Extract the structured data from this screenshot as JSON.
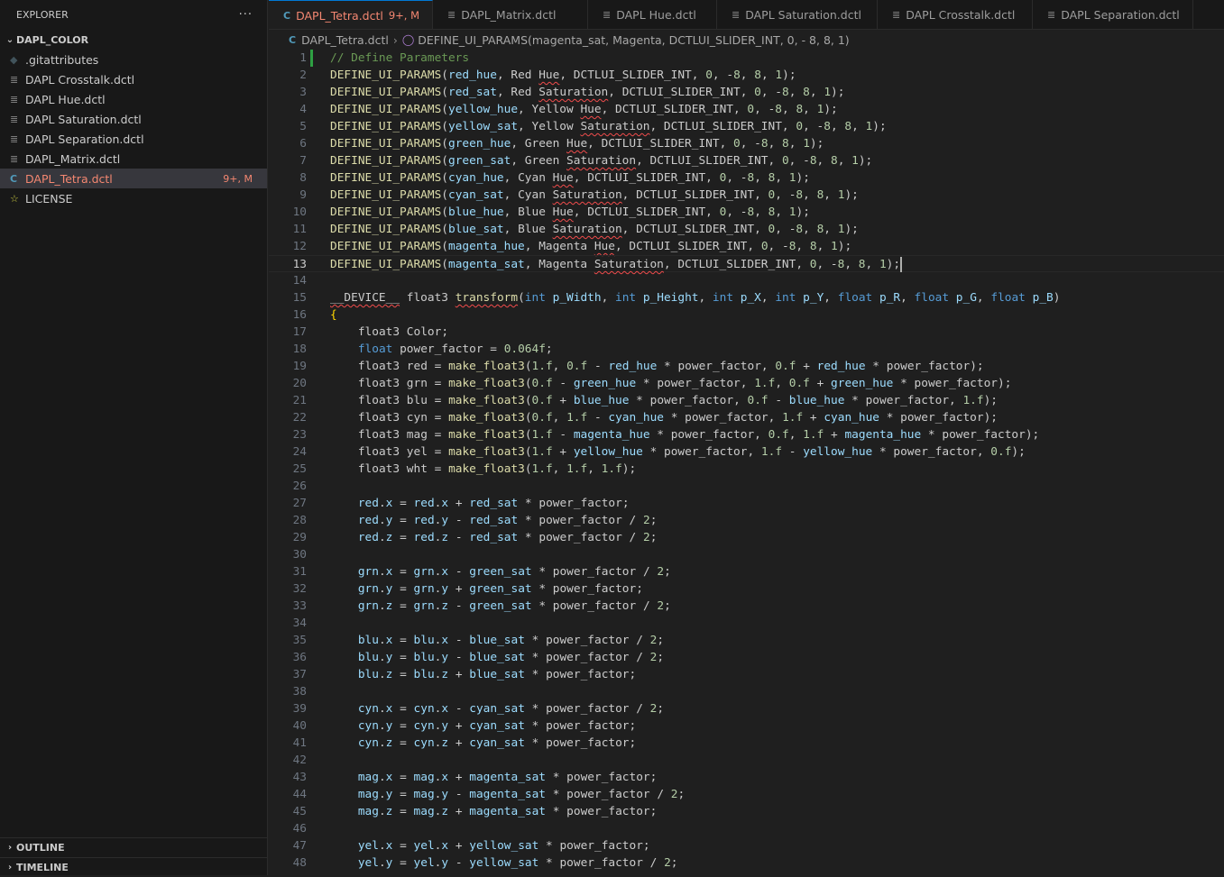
{
  "explorer": {
    "title": "EXPLORER",
    "more_label": "···",
    "folder": "DAPL_COLOR",
    "files": [
      {
        "name": ".gitattributes",
        "icon": "git-icon",
        "badge": ""
      },
      {
        "name": "DAPL Crosstalk.dctl",
        "icon": "lines-icon",
        "badge": ""
      },
      {
        "name": "DAPL Hue.dctl",
        "icon": "lines-icon",
        "badge": ""
      },
      {
        "name": "DAPL Saturation.dctl",
        "icon": "lines-icon",
        "badge": ""
      },
      {
        "name": "DAPL Separation.dctl",
        "icon": "lines-icon",
        "badge": ""
      },
      {
        "name": "DAPL_Matrix.dctl",
        "icon": "lines-icon",
        "badge": ""
      },
      {
        "name": "DAPL_Tetra.dctl",
        "icon": "c-icon",
        "badge": "9+, M",
        "active": true
      },
      {
        "name": "LICENSE",
        "icon": "license-icon",
        "badge": ""
      }
    ],
    "outline_label": "OUTLINE",
    "timeline_label": "TIMELINE"
  },
  "tabs": [
    {
      "label": "DAPL_Tetra.dctl",
      "badge": "9+, M",
      "icon": "c-icon",
      "active": true,
      "dirty": true
    },
    {
      "label": "DAPL_Matrix.dctl",
      "icon": "lines-icon"
    },
    {
      "label": "DAPL Hue.dctl",
      "icon": "lines-icon"
    },
    {
      "label": "DAPL Saturation.dctl",
      "icon": "lines-icon"
    },
    {
      "label": "DAPL Crosstalk.dctl",
      "icon": "lines-icon"
    },
    {
      "label": "DAPL Separation.dctl",
      "icon": "lines-icon"
    }
  ],
  "breadcrumb": {
    "file": "DAPL_Tetra.dctl",
    "symbol": "DEFINE_UI_PARAMS(magenta_sat, Magenta, DCTLUI_SLIDER_INT, 0, - 8, 8, 1)"
  },
  "editor": {
    "current_line": 13,
    "lines": [
      "// Define Parameters",
      "DEFINE_UI_PARAMS(red_hue, Red Hue, DCTLUI_SLIDER_INT, 0, -8, 8, 1);",
      "DEFINE_UI_PARAMS(red_sat, Red Saturation, DCTLUI_SLIDER_INT, 0, -8, 8, 1);",
      "DEFINE_UI_PARAMS(yellow_hue, Yellow Hue, DCTLUI_SLIDER_INT, 0, -8, 8, 1);",
      "DEFINE_UI_PARAMS(yellow_sat, Yellow Saturation, DCTLUI_SLIDER_INT, 0, -8, 8, 1);",
      "DEFINE_UI_PARAMS(green_hue, Green Hue, DCTLUI_SLIDER_INT, 0, -8, 8, 1);",
      "DEFINE_UI_PARAMS(green_sat, Green Saturation, DCTLUI_SLIDER_INT, 0, -8, 8, 1);",
      "DEFINE_UI_PARAMS(cyan_hue, Cyan Hue, DCTLUI_SLIDER_INT, 0, -8, 8, 1);",
      "DEFINE_UI_PARAMS(cyan_sat, Cyan Saturation, DCTLUI_SLIDER_INT, 0, -8, 8, 1);",
      "DEFINE_UI_PARAMS(blue_hue, Blue Hue, DCTLUI_SLIDER_INT, 0, -8, 8, 1);",
      "DEFINE_UI_PARAMS(blue_sat, Blue Saturation, DCTLUI_SLIDER_INT, 0, -8, 8, 1);",
      "DEFINE_UI_PARAMS(magenta_hue, Magenta Hue, DCTLUI_SLIDER_INT, 0, -8, 8, 1);",
      "DEFINE_UI_PARAMS(magenta_sat, Magenta Saturation, DCTLUI_SLIDER_INT, 0, -8, 8, 1);",
      "",
      "__DEVICE__ float3 transform(int p_Width, int p_Height, int p_X, int p_Y, float p_R, float p_G, float p_B)",
      "{",
      "    float3 Color;",
      "    float power_factor = 0.064f;",
      "    float3 red = make_float3(1.f, 0.f - red_hue * power_factor, 0.f + red_hue * power_factor);",
      "    float3 grn = make_float3(0.f - green_hue * power_factor, 1.f, 0.f + green_hue * power_factor);",
      "    float3 blu = make_float3(0.f + blue_hue * power_factor, 0.f - blue_hue * power_factor, 1.f);",
      "    float3 cyn = make_float3(0.f, 1.f - cyan_hue * power_factor, 1.f + cyan_hue * power_factor);",
      "    float3 mag = make_float3(1.f - magenta_hue * power_factor, 0.f, 1.f + magenta_hue * power_factor);",
      "    float3 yel = make_float3(1.f + yellow_hue * power_factor, 1.f - yellow_hue * power_factor, 0.f);",
      "    float3 wht = make_float3(1.f, 1.f, 1.f);",
      "",
      "    red.x = red.x + red_sat * power_factor;",
      "    red.y = red.y - red_sat * power_factor / 2;",
      "    red.z = red.z - red_sat * power_factor / 2;",
      "",
      "    grn.x = grn.x - green_sat * power_factor / 2;",
      "    grn.y = grn.y + green_sat * power_factor;",
      "    grn.z = grn.z - green_sat * power_factor / 2;",
      "",
      "    blu.x = blu.x - blue_sat * power_factor / 2;",
      "    blu.y = blu.y - blue_sat * power_factor / 2;",
      "    blu.z = blu.z + blue_sat * power_factor;",
      "",
      "    cyn.x = cyn.x - cyan_sat * power_factor / 2;",
      "    cyn.y = cyn.y + cyan_sat * power_factor;",
      "    cyn.z = cyn.z + cyan_sat * power_factor;",
      "",
      "    mag.x = mag.x + magenta_sat * power_factor;",
      "    mag.y = mag.y - magenta_sat * power_factor / 2;",
      "    mag.z = mag.z + magenta_sat * power_factor;",
      "",
      "    yel.x = yel.x + yellow_sat * power_factor;",
      "    yel.y = yel.y - yellow_sat * power_factor / 2;"
    ]
  },
  "colors": {
    "accent": "#0078d4",
    "modified": "#f48771",
    "git_added": "#2ea043",
    "error_squiggle": "#f14c4c"
  }
}
